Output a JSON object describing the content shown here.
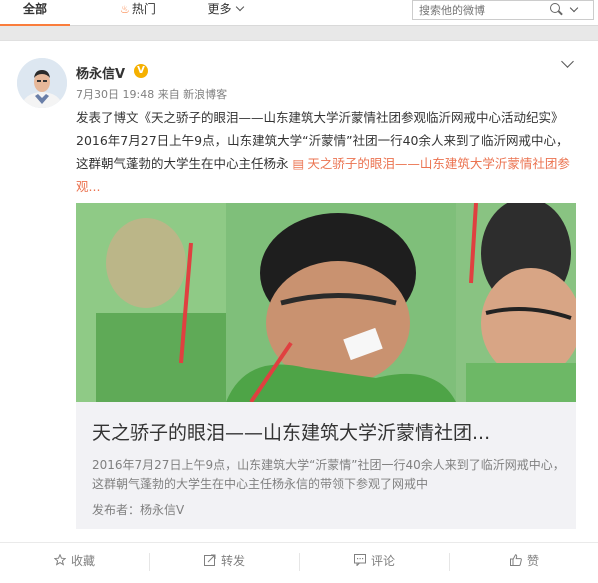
{
  "tabs": {
    "all": "全部",
    "hot": "热门",
    "more": "更多"
  },
  "search": {
    "placeholder": "搜索他的微博"
  },
  "post": {
    "username": "杨永信V",
    "verified_badge": "V",
    "meta": "7月30日 19:48 来自 新浪博客",
    "text_prefix": "发表了博文《天之骄子的眼泪——山东建筑大学沂蒙情社团参观临沂网戒中心活动纪实》2016年7月27日上午9点，山东建筑大学“沂蒙情”社团一行40余人来到了临沂网戒中心，这群朝气蓬勃的大学生在中心主任杨永",
    "link_icon": "▤",
    "link_text": "天之骄子的眼泪——山东建筑大学沂蒙情社团参观..."
  },
  "article": {
    "title": "天之骄子的眼泪——山东建筑大学沂蒙情社团...",
    "summary": "2016年7月27日上午9点，山东建筑大学“沂蒙情”社团一行40余人来到了临沂网戒中心，这群朝气蓬勃的大学生在中心主任杨永信的带领下参观了网戒中",
    "author": "发布者：杨永信V"
  },
  "actions": {
    "favorite": "收藏",
    "repost": "转发",
    "comment": "评论",
    "like": "赞"
  },
  "colors": {
    "accent": "#fa7d3c",
    "link": "#eb7350",
    "badge": "#f5b000"
  }
}
